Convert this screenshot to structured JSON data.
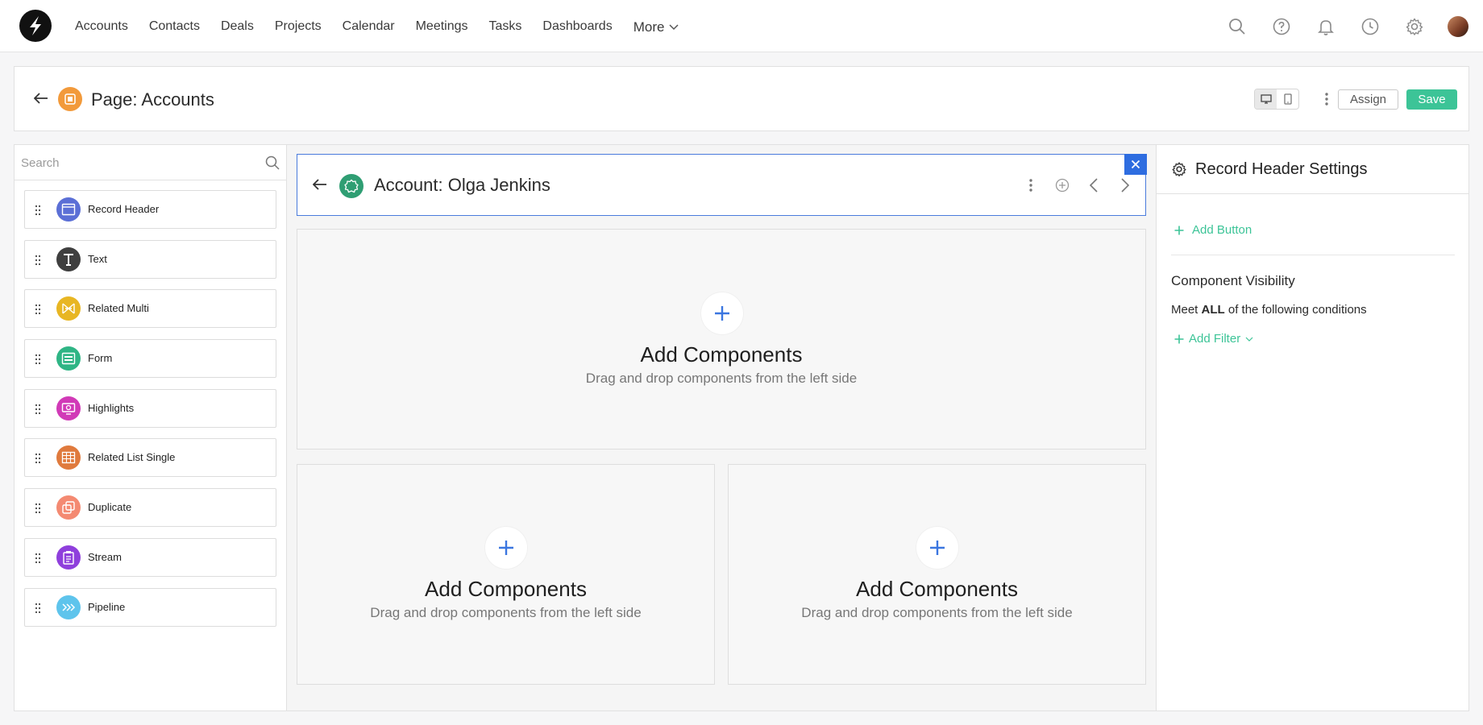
{
  "nav": {
    "items": [
      "Accounts",
      "Contacts",
      "Deals",
      "Projects",
      "Calendar",
      "Meetings",
      "Tasks",
      "Dashboards"
    ],
    "more_label": "More",
    "icons": [
      "search-icon",
      "help-icon",
      "bell-icon",
      "clock-icon",
      "gear-icon",
      "avatar"
    ]
  },
  "page_header": {
    "title": "Page: Accounts",
    "assign_label": "Assign",
    "save_label": "Save"
  },
  "left_panel": {
    "search_placeholder": "Search",
    "components": [
      {
        "label": "Record Header",
        "icon": "record-header-icon",
        "color": "#5b6fd6"
      },
      {
        "label": "Text",
        "icon": "text-icon",
        "color": "#3f3f3f"
      },
      {
        "label": "Related Multi",
        "icon": "related-multi-icon",
        "color": "#e8b623"
      },
      {
        "label": "Form",
        "icon": "form-icon",
        "color": "#2fb585"
      },
      {
        "label": "Highlights",
        "icon": "highlights-icon",
        "color": "#d13ab7"
      },
      {
        "label": "Related List Single",
        "icon": "related-list-icon",
        "color": "#e07a3d"
      },
      {
        "label": "Duplicate",
        "icon": "duplicate-icon",
        "color": "#f48a72"
      },
      {
        "label": "Stream",
        "icon": "stream-icon",
        "color": "#8f3fdc"
      },
      {
        "label": "Pipeline",
        "icon": "pipeline-icon",
        "color": "#5ec4ec"
      }
    ]
  },
  "record_header": {
    "title": "Account: Olga Jenkins"
  },
  "drop_zones": [
    {
      "title": "Add Components",
      "subtitle": "Drag and drop components from the left side"
    },
    {
      "title": "Add Components",
      "subtitle": "Drag and drop components from the left side"
    },
    {
      "title": "Add Components",
      "subtitle": "Drag and drop components from the left side"
    }
  ],
  "right_panel": {
    "title": "Record Header Settings",
    "add_button_label": "Add Button",
    "visibility_title": "Component Visibility",
    "condition_prefix": "Meet",
    "condition_bold": "ALL",
    "condition_suffix": "of the following conditions",
    "add_filter_label": "Add Filter"
  },
  "colors": {
    "accent_green": "#3cc497",
    "accent_blue": "#2e6de0",
    "page_icon": "#f29a3b",
    "record_icon": "#2f9e73"
  }
}
